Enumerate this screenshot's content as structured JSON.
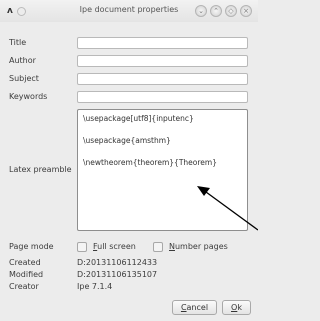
{
  "window": {
    "title": "Ipe document properties",
    "menu_glyph": "ʌ",
    "buttons": [
      "minimize-icon",
      "maximize-icon",
      "restore-icon",
      "close-icon"
    ]
  },
  "labels": {
    "title": "Title",
    "author": "Author",
    "subject": "Subject",
    "keywords": "Keywords",
    "preamble": "Latex preamble",
    "page_mode": "Page mode",
    "created": "Created",
    "modified": "Modified",
    "creator": "Creator"
  },
  "fields": {
    "title": "",
    "author": "",
    "subject": "",
    "keywords": ""
  },
  "preamble_lines": [
    "\\usepackage[utf8]{inputenc}",
    "\\usepackage{amsthm}",
    "\\newtheorem{theorem}{Theorem}"
  ],
  "page_mode": {
    "full_screen_first": "F",
    "full_screen_rest": "ull screen",
    "full_screen_checked": false,
    "number_pages_first": "N",
    "number_pages_rest": "umber pages",
    "number_pages_checked": false
  },
  "info": {
    "created": "D:20131106112433",
    "modified": "D:20131106135107",
    "creator": "Ipe 7.1.4"
  },
  "buttons": {
    "cancel_first": "C",
    "cancel_rest": "ancel",
    "ok_first": "O",
    "ok_rest": "k"
  }
}
